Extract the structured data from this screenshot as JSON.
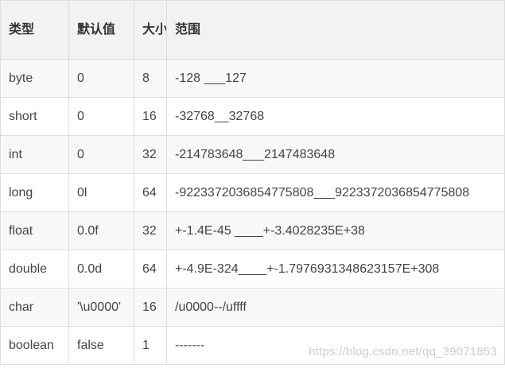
{
  "table": {
    "headers": {
      "type": "类型",
      "default": "默认值",
      "size": "大小",
      "range": "范围"
    },
    "rows": [
      {
        "type": "byte",
        "default": "0",
        "size": "8",
        "range": "-128 ___127"
      },
      {
        "type": "short",
        "default": "0",
        "size": "16",
        "range": "-32768__32768"
      },
      {
        "type": "int",
        "default": "0",
        "size": "32",
        "range": "-214783648___2147483648"
      },
      {
        "type": "long",
        "default": "0l",
        "size": "64",
        "range": "-9223372036854775808___9223372036854775808"
      },
      {
        "type": "float",
        "default": "0.0f",
        "size": "32",
        "range": "+-1.4E-45 ____+-3.4028235E+38"
      },
      {
        "type": "double",
        "default": "0.0d",
        "size": "64",
        "range": "+-4.9E-324____+-1.7976931348623157E+308"
      },
      {
        "type": "char",
        "default": "'\\u0000'",
        "size": "16",
        "range": "/u0000--/uffff"
      },
      {
        "type": "boolean",
        "default": "false",
        "size": "1",
        "range": "-------"
      }
    ]
  },
  "watermark": "https://blog.csdn.net/qq_39071853"
}
